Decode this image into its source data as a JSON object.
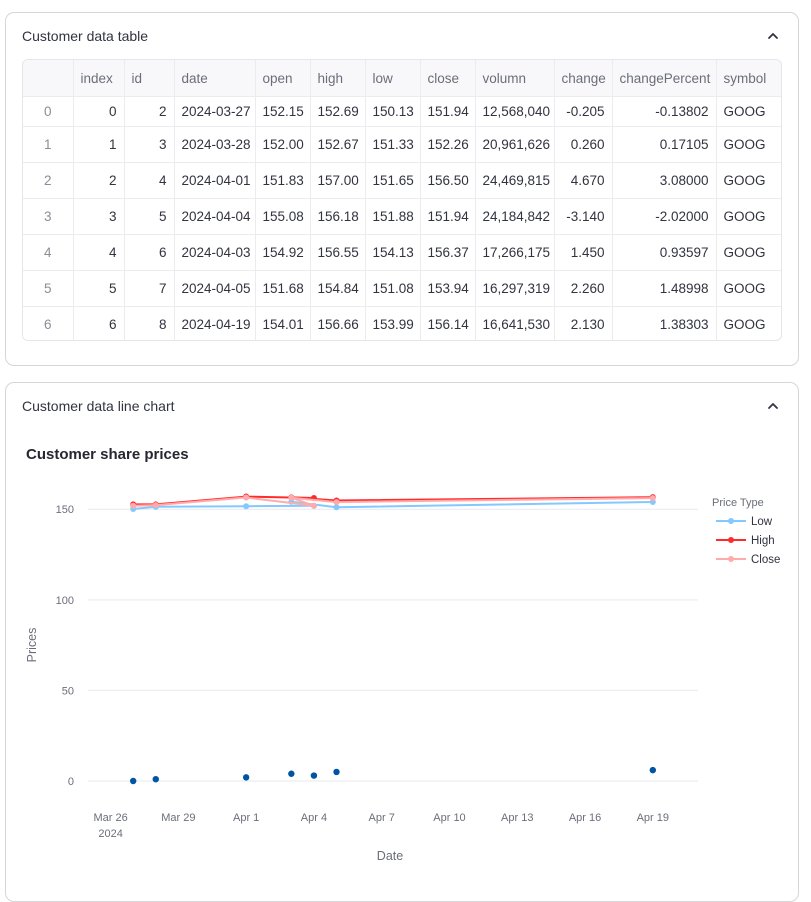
{
  "table_section": {
    "title": "Customer data table",
    "columns": [
      "",
      "index",
      "id",
      "date",
      "open",
      "high",
      "low",
      "close",
      "volumn",
      "change",
      "changePercent",
      "symbol"
    ],
    "rows": [
      [
        "0",
        "0",
        "2",
        "2024-03-27",
        "152.15",
        "152.69",
        "150.13",
        "151.94",
        "12,568,040",
        "-0.205",
        "-0.13802",
        "GOOG"
      ],
      [
        "1",
        "1",
        "3",
        "2024-03-28",
        "152.00",
        "152.67",
        "151.33",
        "152.26",
        "20,961,626",
        "0.260",
        "0.17105",
        "GOOG"
      ],
      [
        "2",
        "2",
        "4",
        "2024-04-01",
        "151.83",
        "157.00",
        "151.65",
        "156.50",
        "24,469,815",
        "4.670",
        "3.08000",
        "GOOG"
      ],
      [
        "3",
        "3",
        "5",
        "2024-04-04",
        "155.08",
        "156.18",
        "151.88",
        "151.94",
        "24,184,842",
        "-3.140",
        "-2.02000",
        "GOOG"
      ],
      [
        "4",
        "4",
        "6",
        "2024-04-03",
        "154.92",
        "156.55",
        "154.13",
        "156.37",
        "17,266,175",
        "1.450",
        "0.93597",
        "GOOG"
      ],
      [
        "5",
        "5",
        "7",
        "2024-04-05",
        "151.68",
        "154.84",
        "151.08",
        "153.94",
        "16,297,319",
        "2.260",
        "1.48998",
        "GOOG"
      ],
      [
        "6",
        "6",
        "8",
        "2024-04-19",
        "154.01",
        "156.66",
        "153.99",
        "156.14",
        "16,641,530",
        "2.130",
        "1.38303",
        "GOOG"
      ]
    ]
  },
  "chart_section": {
    "title": "Customer data line chart"
  },
  "chart_data": {
    "type": "line",
    "title": "Customer share prices",
    "xlabel": "Date",
    "ylabel": "Prices",
    "ylim": [
      0,
      170
    ],
    "yticks": [
      0,
      50,
      100,
      150
    ],
    "xlim": [
      "2024-03-25",
      "2024-04-21"
    ],
    "xticks": [
      {
        "date": "2024-03-26",
        "label": "Mar 26",
        "sub": "2024"
      },
      {
        "date": "2024-03-29",
        "label": "Mar 29"
      },
      {
        "date": "2024-04-01",
        "label": "Apr 1"
      },
      {
        "date": "2024-04-04",
        "label": "Apr 4"
      },
      {
        "date": "2024-04-07",
        "label": "Apr 7"
      },
      {
        "date": "2024-04-10",
        "label": "Apr 10"
      },
      {
        "date": "2024-04-13",
        "label": "Apr 13"
      },
      {
        "date": "2024-04-16",
        "label": "Apr 16"
      },
      {
        "date": "2024-04-19",
        "label": "Apr 19"
      }
    ],
    "x": [
      "2024-03-27",
      "2024-03-28",
      "2024-04-01",
      "2024-04-04",
      "2024-04-03",
      "2024-04-05",
      "2024-04-19"
    ],
    "legend_title": "Price Type",
    "legend_position": "top-right",
    "grid": true,
    "series": [
      {
        "name": "Low",
        "color": "#83c9ff",
        "values": [
          150.13,
          151.33,
          151.65,
          151.88,
          154.13,
          151.08,
          153.99
        ]
      },
      {
        "name": "High",
        "color": "#ff2b2b",
        "values": [
          152.69,
          152.67,
          157.0,
          156.18,
          156.55,
          154.84,
          156.66
        ]
      },
      {
        "name": "Close",
        "color": "#ffabab",
        "values": [
          151.94,
          152.26,
          156.5,
          151.94,
          156.37,
          153.94,
          156.14
        ]
      }
    ],
    "points": {
      "color": "#0054a3",
      "values": [
        0,
        1,
        2,
        3,
        4,
        5,
        6
      ]
    }
  }
}
